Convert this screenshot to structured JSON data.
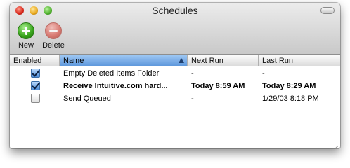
{
  "window": {
    "title": "Schedules"
  },
  "toolbar": {
    "new_label": "New",
    "delete_label": "Delete"
  },
  "table": {
    "columns": [
      "Enabled",
      "Name",
      "Next Run",
      "Last Run"
    ],
    "sorted_column": "Name",
    "rows": [
      {
        "enabled": true,
        "name": "Empty Deleted Items Folder",
        "next_run": "-",
        "last_run": "-",
        "bold": false
      },
      {
        "enabled": true,
        "name": "Receive Intuitive.com hard...",
        "next_run": "Today 8:59 AM",
        "last_run": "Today 8:29 AM",
        "bold": true
      },
      {
        "enabled": false,
        "name": "Send Queued",
        "next_run": "-",
        "last_run": "1/29/03 8:18 PM",
        "bold": false
      }
    ]
  },
  "colors": {
    "header_selected": "#5b95db",
    "checkbox_checked": "#4f8ed8"
  }
}
